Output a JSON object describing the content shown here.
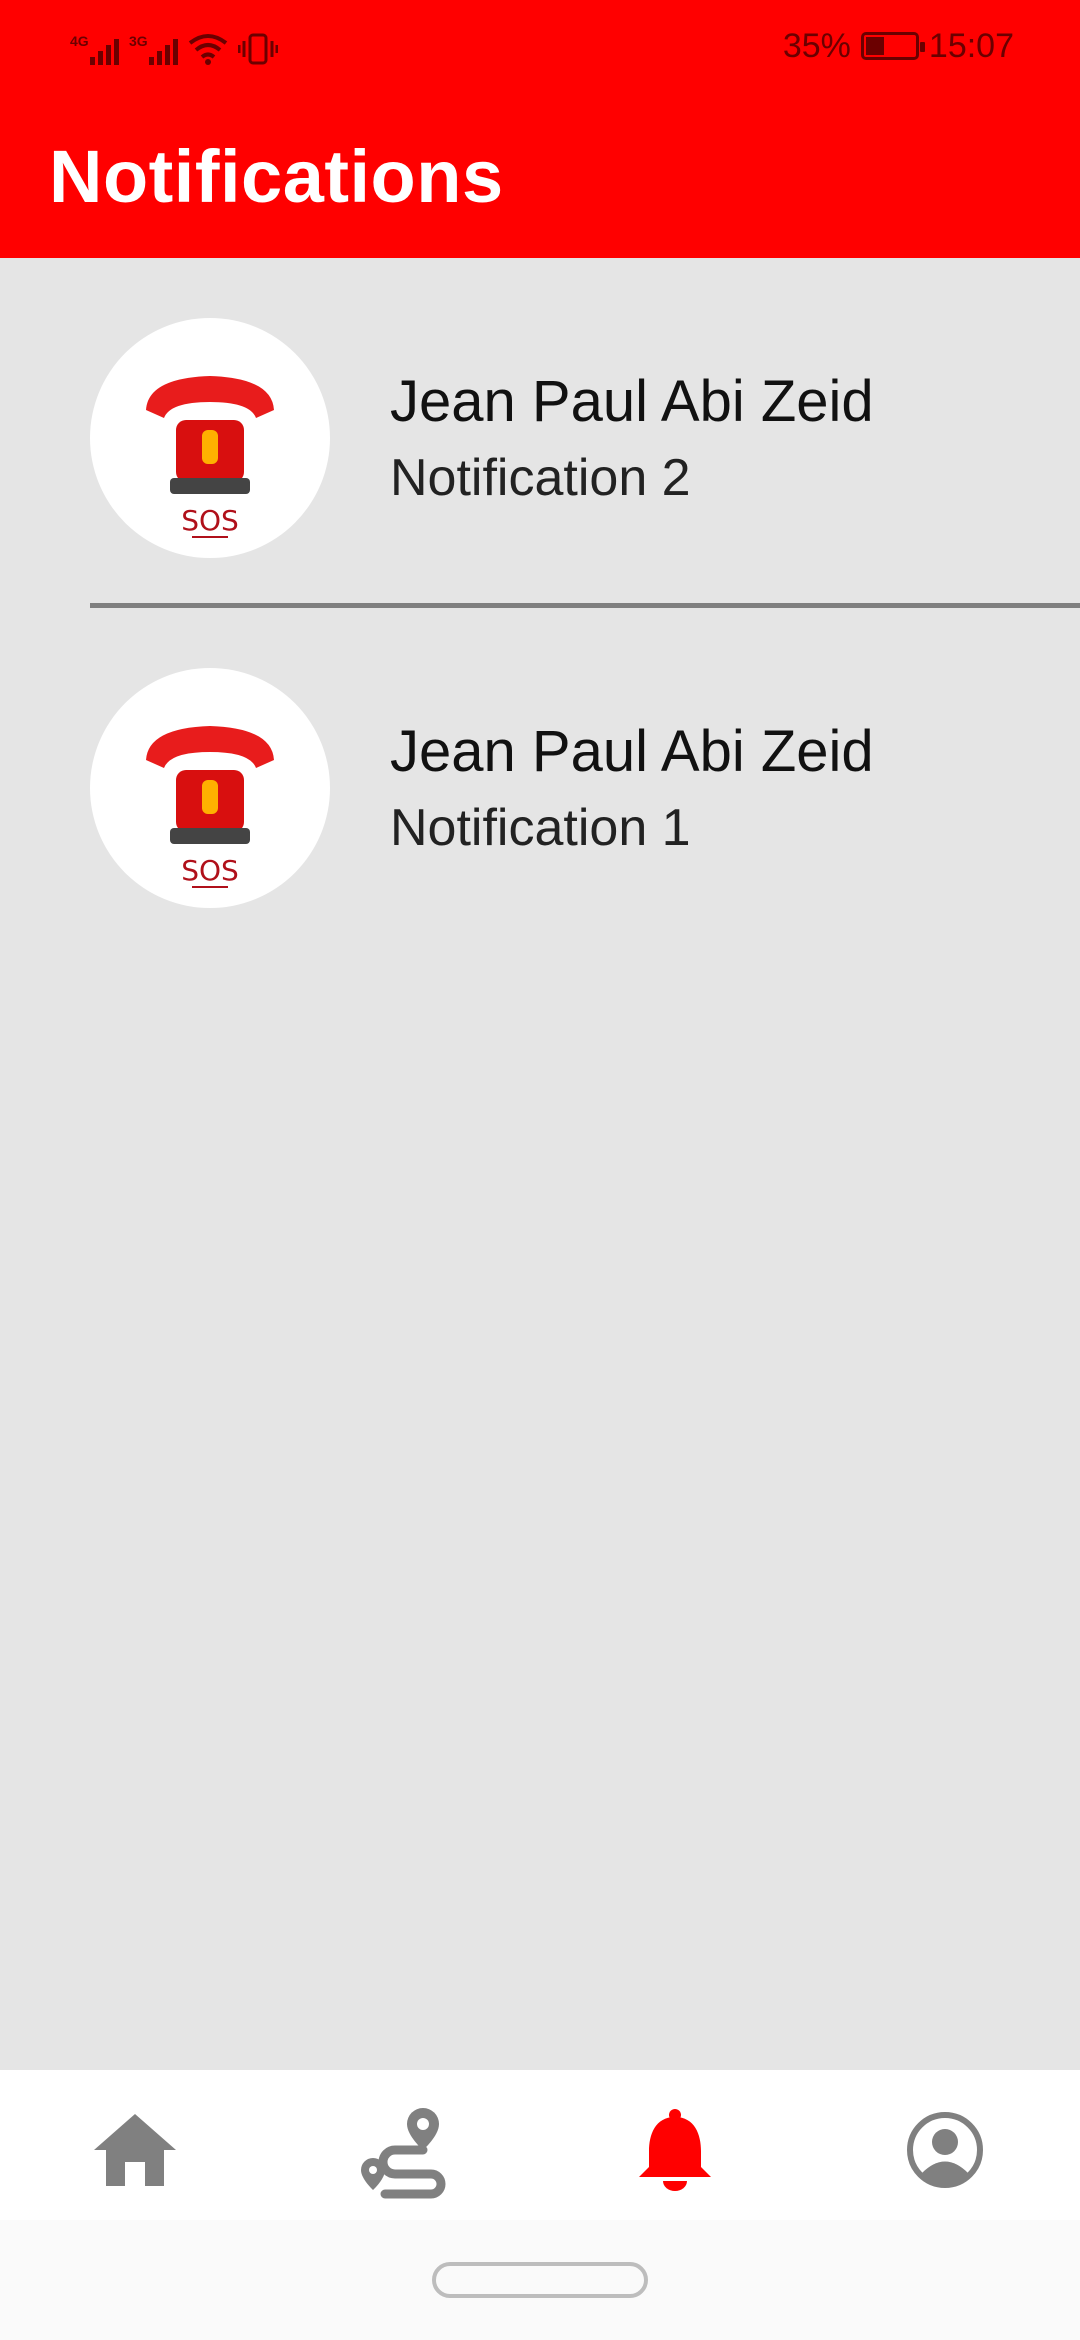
{
  "status_bar": {
    "signal_1_tag": "4G",
    "signal_2_tag": "3G",
    "battery_percent": "35%",
    "battery_level": 0.35,
    "time": "15:07"
  },
  "header": {
    "title": "Notifications"
  },
  "notifications": [
    {
      "name": "Jean Paul Abi Zeid",
      "message": "Notification 2",
      "avatar_label": "SOS"
    },
    {
      "name": "Jean Paul Abi Zeid",
      "message": "Notification 1",
      "avatar_label": "SOS"
    }
  ],
  "bottom_nav": {
    "items": [
      {
        "icon": "home-icon",
        "active": false
      },
      {
        "icon": "route-icon",
        "active": false
      },
      {
        "icon": "bell-icon",
        "active": true
      },
      {
        "icon": "account-circle-icon",
        "active": false
      }
    ],
    "active_color": "#ff0000",
    "inactive_color": "#808080"
  },
  "colors": {
    "accent": "#ff0000",
    "background": "#e5e5e5"
  }
}
